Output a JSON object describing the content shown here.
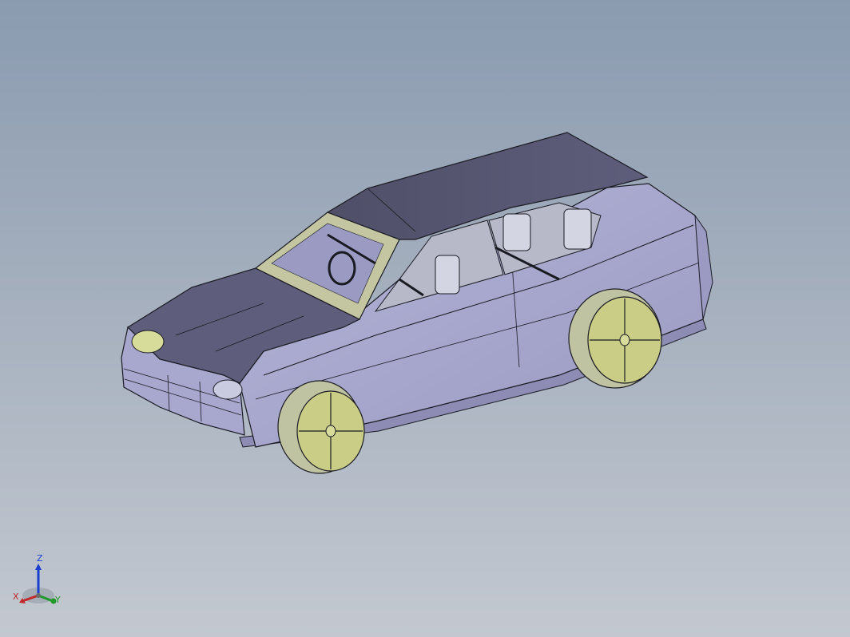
{
  "viewport": {
    "background_top": "#8a9bb0",
    "background_bottom": "#c3c8d0"
  },
  "model": {
    "body_color": "#a7a7cc",
    "body_dark_color": "#5a5a75",
    "edge_color": "#1a1a22",
    "accent_color": "#d8dc9a"
  },
  "triad": {
    "x_label": "X",
    "y_label": "Y",
    "z_label": "Z",
    "x_color": "#c0282a",
    "y_color": "#1f9a2a",
    "z_color": "#1a3fd0"
  }
}
